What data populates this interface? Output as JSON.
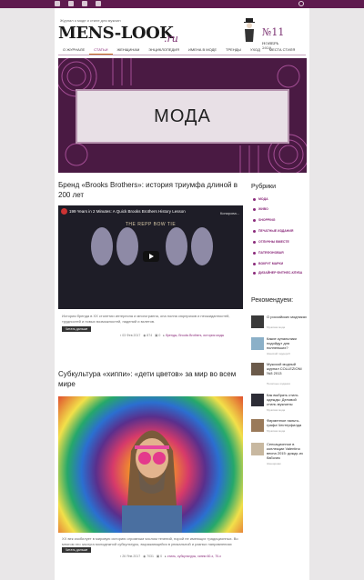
{
  "header": {
    "tagline": "Журнал о моде и стиле для мужчин",
    "logo": "MENS-LOOK",
    "logo_suffix": ".ru",
    "issue_number": "№11",
    "issue_month": "НОЯБРЬ",
    "issue_year": "2020"
  },
  "nav": [
    "О журнале",
    "Статьи",
    "Женщинам",
    "Энциклопедия",
    "Имена в моде",
    "Тренды",
    "Уход",
    "Места стиля"
  ],
  "banner": {
    "label": "МОДА"
  },
  "posts": [
    {
      "title": "Бренд «Brooks Brothers»: история триумфа длиной в 200 лет",
      "video_title": "199 Years in 2 Minutes: A Quick Brooks Brothers History Lesson",
      "video_copy": "Копирова...",
      "video_subtitle": "THE REPP BOW TIE",
      "excerpt": "История бренда в XX столетии интересна и многогранна, она полна сюрпризов и неожиданностей, трудностей и новых возможностей, падений и взлетов.",
      "read_more": "Читать дальше",
      "date": "03 Фев 2017",
      "views": "874",
      "comments": "0",
      "tags": "бренды, Brooks Brothers, история моды"
    },
    {
      "title": "Субкультура «хиппи»: «дети цветов» за мир во всем мире",
      "excerpt": "XX век изобилует в мировую историю огромным числом течений, порой не имеющих традиционных. Во многом это заслуга молодежной субкультуры, выражающейся в уникальной и разных направлениях этого столетия.",
      "read_more": "Читать дальше",
      "date": "26 Янв 2017",
      "views": "7031",
      "comments": "0",
      "tags": "стиль, субкультуры, хиппи 60-х, 70-х"
    }
  ],
  "sidebar": {
    "rubrics_title": "Рубрики",
    "rubrics": [
      "МОДА",
      "ЖИВО",
      "SHOPPING",
      "ПЕЧАТНЫЕ ИЗДАНИЯ",
      "ОТЛИЧНЫ ВМЕСТЕ",
      "ПАТЕФОНОВАЯ",
      "ВОКРУГ МАРКИ",
      "ДИЗАЙНЕР ФИТНЕС-КЛУБА"
    ],
    "recommend_title": "Рекомендуем:",
    "recommended": [
      {
        "title": "О российских модниках",
        "cat": "Мужская мода"
      },
      {
        "title": "Какие купальники подойдут для полненьких?",
        "cat": "Женский гардероб"
      },
      {
        "title": "Мужской модный журнал COLLEZIONI №3 2013",
        "cat": "Печатные издания"
      },
      {
        "title": "Как выбрать стиль одежды: Деловой стиль мужчины",
        "cat": "Мужская мода"
      },
      {
        "title": "Фирменное пальто-графа Честерфилда",
        "cat": "Мужская мода"
      },
      {
        "title": "Сенсационное в коллекции Valentino весна 2015: дождь из бабочек",
        "cat": "Женщинам"
      }
    ]
  },
  "colors": {
    "brand": "#5e1a4e",
    "accent": "#8a2a7a",
    "highlight": "#c86a1a"
  }
}
